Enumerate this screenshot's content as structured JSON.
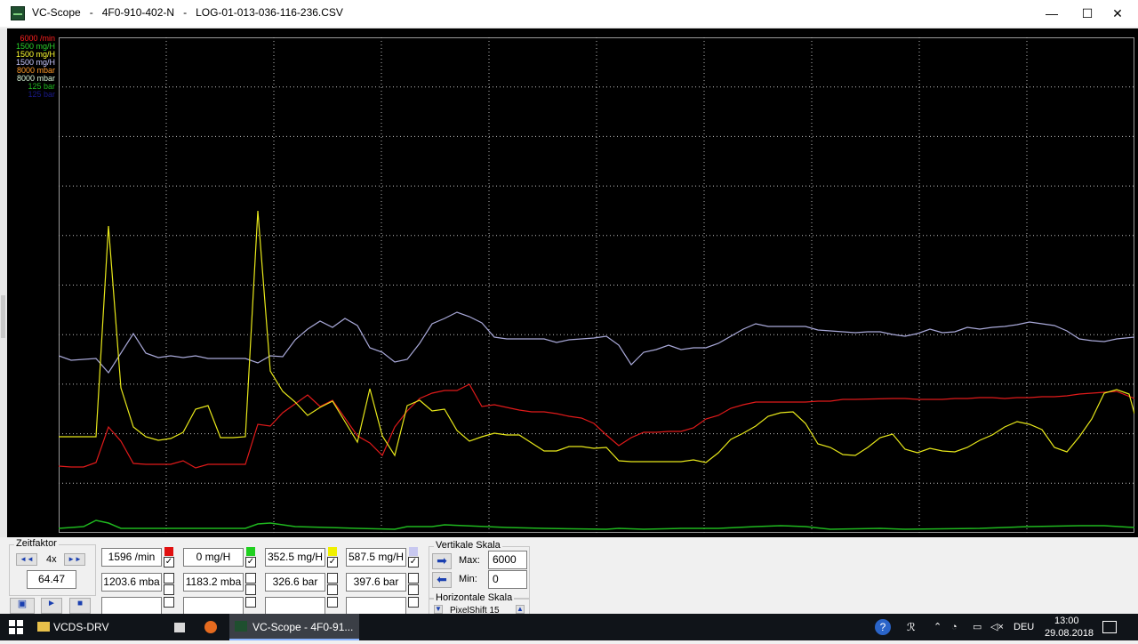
{
  "window": {
    "title": "VC-Scope   -   4F0-910-402-N   -   LOG-01-013-036-116-236.CSV",
    "minimize": "—",
    "maximize": "☐",
    "close": "✕"
  },
  "scope": {
    "scale_labels": [
      {
        "text": "6000 /min",
        "color": "#ff2020"
      },
      {
        "text": "1500 mg/H",
        "color": "#2bd12b"
      },
      {
        "text": "1500 mg/H",
        "color": "#ffff30"
      },
      {
        "text": "1500 mg/H",
        "color": "#c8c8ff"
      },
      {
        "text": "8000 mbar",
        "color": "#ff9a2a"
      },
      {
        "text": "8000 mbar",
        "color": "#d9f7d9"
      },
      {
        "text": "125 bar",
        "color": "#1fb81f"
      },
      {
        "text": "125 bar",
        "color": "#1a1a8a"
      }
    ],
    "traces": {
      "lavender": {
        "color": "#a9a9d9"
      },
      "red": {
        "color": "#e01a1a"
      },
      "yellow": {
        "color": "#e8e81a"
      },
      "green": {
        "color": "#1fb81f"
      }
    }
  },
  "panel": {
    "zeitfaktor": {
      "title": "Zeitfaktor",
      "factor": "4x",
      "value": "64.47",
      "rewind": "◄◄",
      "forward": "►►"
    },
    "channels": [
      {
        "value": "1596 /min",
        "value2": "1203.6 mba",
        "swatch": "#e01010",
        "checked": true
      },
      {
        "value": "0 mg/H",
        "value2": "1183.2 mba",
        "swatch": "#20d020",
        "checked": true
      },
      {
        "value": "352.5 mg/H",
        "value2": "326.6 bar",
        "swatch": "#f0f000",
        "checked": true
      },
      {
        "value": "587.5 mg/H",
        "value2": "397.6 bar",
        "swatch": "#c8c8f0",
        "checked": true
      }
    ],
    "vertikale": {
      "title": "Vertikale Skala",
      "max_label": "Max:",
      "max": "6000",
      "min_label": "Min:",
      "min": "0"
    },
    "horizontale": {
      "title": "Horizontale Skala",
      "pixelshift": "PixelShift 15"
    }
  },
  "taskbar": {
    "items": [
      {
        "label": "VCDS-DRV"
      },
      {
        "label": "VC-Scope  -  4F0-91..."
      }
    ],
    "language": "DEU",
    "time": "13:00",
    "date": "29.08.2018"
  }
}
